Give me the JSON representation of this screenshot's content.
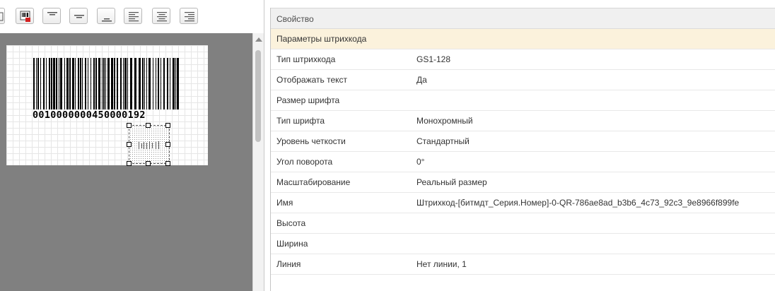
{
  "toolbar": {
    "buttons": [
      {
        "icon": "partial-button-icon"
      },
      {
        "icon": "barcode-settings-icon"
      },
      {
        "icon": "align-top-icon"
      },
      {
        "icon": "align-middle-icon"
      },
      {
        "icon": "align-bottom-icon"
      },
      {
        "icon": "align-left-icon"
      },
      {
        "icon": "align-center-icon"
      },
      {
        "icon": "align-right-icon"
      }
    ]
  },
  "designer": {
    "barcode_digits": "0010000000450000192"
  },
  "properties": {
    "header": "Свойство",
    "rows": [
      {
        "key": "Параметры штрихкода",
        "value": "",
        "group": true
      },
      {
        "key": "Тип штрихкода",
        "value": "GS1-128"
      },
      {
        "key": "Отображать текст",
        "value": "Да"
      },
      {
        "key": "Размер шрифта",
        "value": ""
      },
      {
        "key": "Тип шрифта",
        "value": "Монохромный"
      },
      {
        "key": "Уровень четкости",
        "value": "Стандартный"
      },
      {
        "key": "Угол поворота",
        "value": "0°"
      },
      {
        "key": "Масштабирование",
        "value": "Реальный размер"
      },
      {
        "key": "Имя",
        "value": "Штрихкод-[битмдт_Серия.Номер]-0-QR-786ae8ad_b3b6_4c73_92c3_9e8966f899fe"
      },
      {
        "key": "Высота",
        "value": ""
      },
      {
        "key": "Ширина",
        "value": ""
      },
      {
        "key": "Линия",
        "value": "Нет линии, 1"
      }
    ]
  }
}
